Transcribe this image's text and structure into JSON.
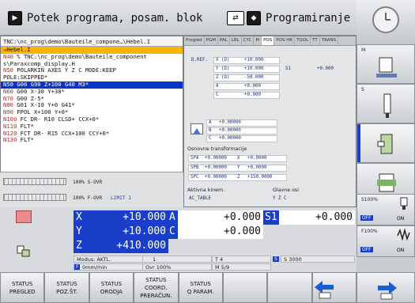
{
  "topbar": {
    "left_mode": "Potek programa, posam. blok",
    "right_mode": "Programiranje"
  },
  "program": {
    "path": "TNC:\\nc_prog\\demo\\Bauteile_compone…\\Hebel.I",
    "lines": [
      {
        "text": "→Hebel.I",
        "style": "sel"
      },
      {
        "no": "N40",
        "text": " % TNC:\\nc_prog\\demo\\Bauteile_component"
      },
      {
        "text": "   s\\Paraxcomp_display.H"
      },
      {
        "no": "N50",
        "text": " POLARKIN AXES Y Z C MODE:KEEP"
      },
      {
        "text": "   POLE:SKIPPED*"
      },
      {
        "no": "N50",
        "text": " G00 G90 Z+100 G40 M3*",
        "style": "hl"
      },
      {
        "no": "N60",
        "text": " G00 X-30 Y+30*"
      },
      {
        "no": "N70",
        "text": " G00 Z-5*"
      },
      {
        "no": "N80",
        "text": " G01 X-10 Y+0 G41*"
      },
      {
        "no": "N90",
        "text": " FPOL X+100 Y+0*"
      },
      {
        "no": "N100",
        "text": " FC DR- R10 CLSD+ CCX+0*"
      },
      {
        "no": "N110",
        "text": " FLT*"
      },
      {
        "no": "N120",
        "text": " FCT DR- R15 CCX+100 CCY+0*"
      },
      {
        "no": "N130",
        "text": " FLT*"
      }
    ]
  },
  "override": {
    "s_label": "100% S-OVR",
    "f_label": "100% F-OVR",
    "limit": "LIMIT 1"
  },
  "tabs": [
    "Pregled",
    "PGM",
    "PAL",
    "LBL",
    "CYC",
    "M",
    "POS",
    "POS HR",
    "TOOL",
    "TT",
    "TRANS"
  ],
  "pos": {
    "dref": "D.REF.",
    "rows": [
      [
        "X (D)",
        "+10.000"
      ],
      [
        "Y (D)",
        "+10.000"
      ],
      [
        "Z (D)",
        "-50.000"
      ],
      [
        "A",
        "+0.000"
      ],
      [
        "C",
        "+0.000"
      ]
    ],
    "s1": "S1",
    "s1v": "+0.000"
  },
  "rot": [
    [
      "A",
      "+0.00000"
    ],
    [
      "B",
      "+0.00000"
    ],
    [
      "C",
      "+0.00000"
    ]
  ],
  "basic_title": "Osnovne transformacije",
  "basic": [
    [
      "SPA",
      "+0.00000",
      "X",
      "+0.0000"
    ],
    [
      "SPB",
      "+0.00000",
      "Y",
      "+0.0000"
    ],
    [
      "SPC",
      "+0.00000",
      "Z",
      "+150.0000"
    ]
  ],
  "kin_title": "Aktivna kinem.",
  "kin_val": "AC_TABLE",
  "axes_title": "Glavne osi",
  "axes_val": "Y Z C",
  "axes": [
    {
      "name": "X",
      "val": "+10.000"
    },
    {
      "name": "Y",
      "val": "+10.000"
    },
    {
      "name": "Z",
      "val": "+410.000"
    }
  ],
  "axes2": [
    {
      "name": "A",
      "val": "+0.000"
    },
    {
      "name": "C",
      "val": "+0.000"
    }
  ],
  "s1": {
    "name": "S1",
    "val": "+0.000"
  },
  "modal": {
    "mode": "Modus: AKTL.",
    "feed": "0mm/min",
    "ovr": "Ovr 100%",
    "t": "T 4",
    "m": "M 5/9",
    "s": "S 3000",
    "tool": "1"
  },
  "side": {
    "m": "M",
    "s": "S",
    "s100": "S100%",
    "f100": "F100%",
    "off": "OFF",
    "on": "ON"
  },
  "softkeys": [
    [
      "STATUS",
      "PREGLED"
    ],
    [
      "STATUS",
      "POZ.ŠT."
    ],
    [
      "STATUS",
      "ORODJA"
    ],
    [
      "STATUS",
      "COORD.",
      "PRERAČUN."
    ],
    [
      "STATUS",
      "Q PARAM."
    ],
    [
      ""
    ],
    [
      ""
    ],
    [
      ""
    ]
  ]
}
